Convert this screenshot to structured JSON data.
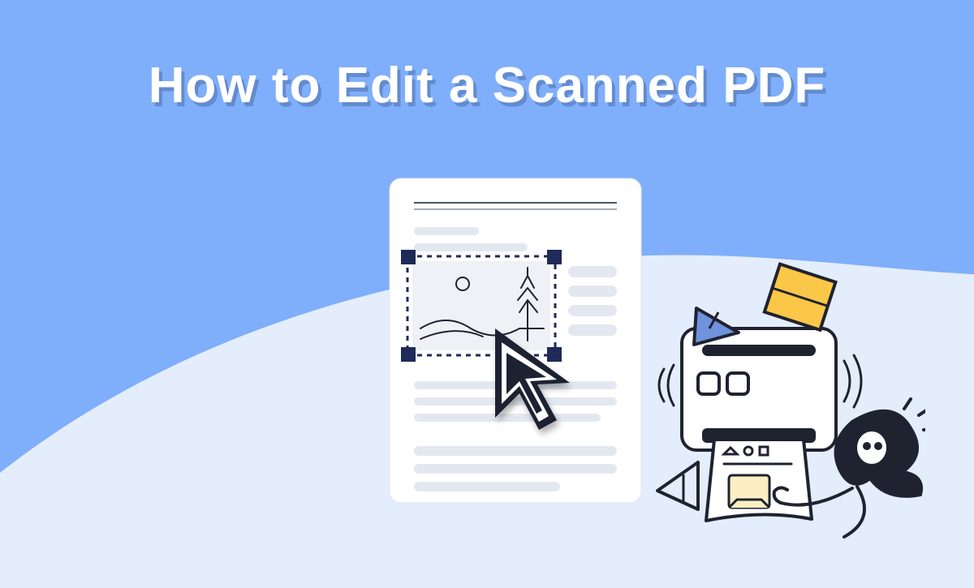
{
  "title": "How to Edit a Scanned PDF",
  "colors": {
    "bg_top": "#7faefb",
    "bg_bottom": "#e4edfc",
    "ink": "#1f2330",
    "accent_navy": "#1f2a58",
    "accent_yellow": "#fbc748",
    "accent_blue": "#5f86d6",
    "paper": "#ffffff",
    "paper_line": "#e3e8f0"
  }
}
